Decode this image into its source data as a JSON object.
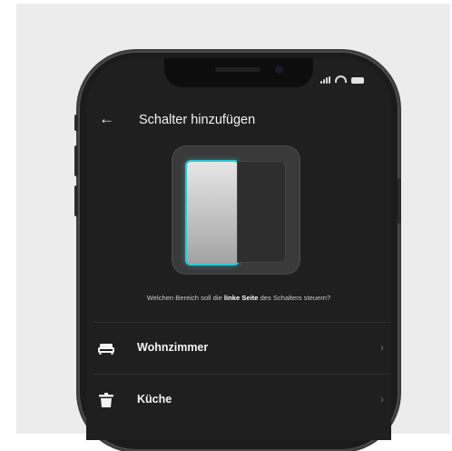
{
  "header": {
    "title": "Schalter hinzufügen",
    "back_icon": "arrow-left-icon"
  },
  "status_bar": {
    "icons": [
      "signal-icon",
      "wifi-icon",
      "battery-icon"
    ]
  },
  "switch_preview": {
    "highlight_color": "#2cc7d6",
    "selected_side": "left"
  },
  "prompt": {
    "before": "Welchen Bereich soll die ",
    "emphasis": "linke Seite",
    "after": " des Schalters steuern?"
  },
  "rooms": [
    {
      "label": "Wohnzimmer",
      "icon": "sofa-icon"
    },
    {
      "label": "Küche",
      "icon": "kitchen-icon"
    }
  ],
  "colors": {
    "screen_bg": "#1f1f1f",
    "accent": "#2cc7d6"
  }
}
